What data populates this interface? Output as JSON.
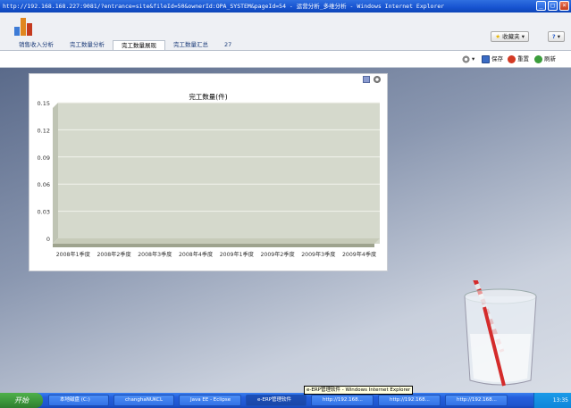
{
  "window": {
    "title": "http://192.168.168.227:9081/?entrance=site&fileId=50&ownerId:OPA_SYSTEM&pageId=54 - 运营分析_多维分析 - Windows Internet Explorer"
  },
  "header": {
    "favorites_label": "收藏夹 ▾",
    "help_icon": "help-icon",
    "tabs": [
      {
        "label": "销售收入分析",
        "active": false
      },
      {
        "label": "完工数量分析",
        "active": false
      },
      {
        "label": "完工数量展现",
        "active": true
      },
      {
        "label": "完工数量汇总",
        "active": false
      },
      {
        "label": "27",
        "active": false
      }
    ]
  },
  "toolbar": {
    "gear_label": "▾",
    "save_label": "保存",
    "reset_label": "重置",
    "refresh_label": "刷新"
  },
  "chart_data": {
    "type": "bar",
    "title": "完工数量(件)",
    "categories": [
      "2008年1季度",
      "2008年2季度",
      "2008年3季度",
      "2008年4季度",
      "2009年1季度",
      "2009年2季度",
      "2009年3季度",
      "2009年4季度"
    ],
    "values": [
      0,
      0,
      0,
      0,
      0,
      0,
      0,
      0
    ],
    "yticks": [
      "0",
      "0.03",
      "0.06",
      "0.09",
      "0.12",
      "0.15"
    ],
    "ylim": [
      0,
      0.15
    ],
    "grid": true,
    "colors": {
      "plot_bg": "#d5d9cc",
      "floor": "#c7cbb9",
      "grid": "#f2f3ec"
    }
  },
  "taskbar": {
    "start_label": "开始",
    "tasks": [
      {
        "label": "本地磁盘 (C:)"
      },
      {
        "label": "changhaNUKCL"
      },
      {
        "label": "Java EE - Eclipse"
      },
      {
        "label": "e-ERP管理软件"
      },
      {
        "label": "http://192.168..."
      },
      {
        "label": "http://192.168..."
      },
      {
        "label": "http://192.168..."
      }
    ],
    "tooltip": "e-ERP管理软件 - Windows Internet Explorer",
    "clock": "13:35"
  }
}
